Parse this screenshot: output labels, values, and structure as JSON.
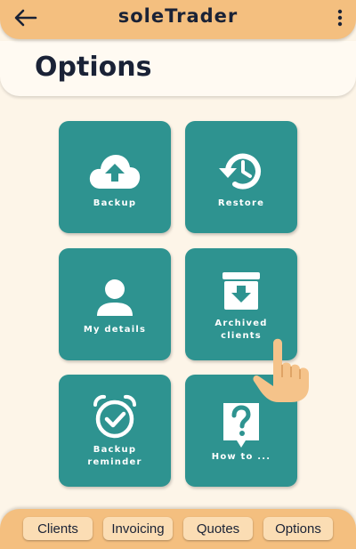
{
  "app": {
    "title": "soleTrader"
  },
  "header": {
    "title": "Options"
  },
  "tiles": [
    {
      "label": "Backup",
      "icon": "cloud-upload-icon"
    },
    {
      "label": "Restore",
      "icon": "restore-history-icon"
    },
    {
      "label": "My details",
      "icon": "person-icon"
    },
    {
      "label": "Archived\nclients",
      "icon": "archive-box-icon"
    },
    {
      "label": "Backup\nreminder",
      "icon": "alarm-clock-check-icon"
    },
    {
      "label": "How to ...",
      "icon": "help-question-icon"
    }
  ],
  "nav": [
    "Clients",
    "Invoicing",
    "Quotes",
    "Options"
  ],
  "colors": {
    "bar": "#f4bf7f",
    "background": "#fdf5e8",
    "tile": "#2e9390",
    "nav_button": "#fbddb4",
    "text_dark": "#1a2236",
    "hand": "#f5c38a"
  }
}
